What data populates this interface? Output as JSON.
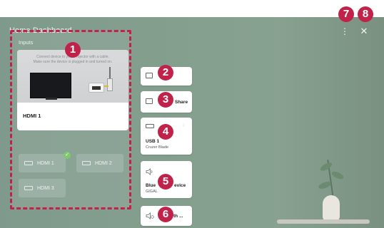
{
  "header": {
    "title": "Home Dashboard",
    "more_icon": "⋮",
    "close_icon": "✕"
  },
  "inputs": {
    "section_label": "Inputs",
    "preview": {
      "message": "Connect device to your Projector with a cable.\nMake sure the device is plugged in and turned on.",
      "caption": "HDMI 1"
    },
    "ports": [
      {
        "label": "HDMI 1",
        "selected": true
      },
      {
        "label": "HDMI 2",
        "selected": false
      },
      {
        "label": "HDMI 3",
        "selected": false
      }
    ],
    "check_glyph": "✓"
  },
  "cards": {
    "share": {
      "label": "Share"
    },
    "usb": {
      "title": "USB 1",
      "subtitle": "Cruzer Blade"
    },
    "bluetooth": {
      "title_left": "Blue",
      "title_right": "evice",
      "subtitle": "GIGAL"
    },
    "sound": {
      "label_left": "",
      "label_right": "th ..."
    }
  },
  "markers": [
    "1",
    "2",
    "3",
    "4",
    "5",
    "6",
    "7",
    "8"
  ],
  "colors": {
    "marker": "#c0224a",
    "background": "#86a08f",
    "check": "#7ec86e"
  }
}
